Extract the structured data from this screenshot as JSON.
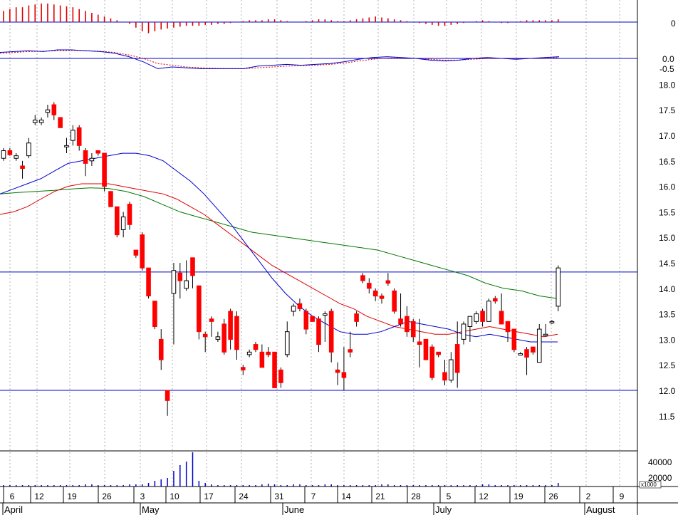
{
  "chart_data": {
    "type": "candlestick",
    "colors": {
      "up": "#ffffff",
      "down": "#ff0000",
      "outline": "#000000",
      "ma_short": "#0000cc",
      "ma_mid": "#dd0000",
      "ma_long": "#007700",
      "hline": "#0000cc",
      "volume": "#0000cc",
      "osc_pos": "#dd0000",
      "macd": "#0000cc",
      "signal": "#dd0000",
      "grid": "#b0b0b0"
    },
    "price_axis": {
      "ylim": [
        11.1,
        18.4
      ],
      "ticks": [
        "18.0",
        "17.5",
        "17.0",
        "16.5",
        "16.0",
        "15.5",
        "15.0",
        "14.5",
        "14.0",
        "13.5",
        "13.0",
        "12.5",
        "12.0",
        "11.5"
      ]
    },
    "osc_axis": {
      "tick": "0"
    },
    "macd_axis": {
      "ticks": [
        "0.0",
        "-0.5"
      ]
    },
    "volume_axis": {
      "ticks": [
        "40000",
        "20000"
      ],
      "unit": "x1000"
    },
    "x_axis": {
      "day_labels": [
        "6",
        "12",
        "19",
        "26",
        "3",
        "10",
        "17",
        "24",
        "31",
        "7",
        "14",
        "21",
        "28",
        "5",
        "12",
        "19",
        "26",
        "2",
        "9"
      ],
      "months": [
        "April",
        "May",
        "June",
        "July",
        "August"
      ]
    },
    "horizontal_lines": [
      14.32,
      12.0
    ],
    "candles": [
      [
        16.55,
        16.75,
        16.5,
        16.7
      ],
      [
        16.7,
        16.75,
        16.6,
        16.62
      ],
      [
        16.55,
        16.65,
        16.5,
        16.6
      ],
      [
        16.4,
        16.5,
        16.15,
        16.35
      ],
      [
        16.6,
        16.95,
        16.55,
        16.85
      ],
      [
        17.25,
        17.4,
        17.2,
        17.3
      ],
      [
        17.25,
        17.35,
        17.2,
        17.3
      ],
      [
        17.45,
        17.6,
        17.35,
        17.5
      ],
      [
        17.6,
        17.65,
        17.3,
        17.4
      ],
      [
        17.35,
        17.35,
        17.15,
        17.15
      ],
      [
        16.8,
        16.95,
        16.65,
        16.8
      ],
      [
        16.9,
        17.2,
        16.8,
        17.1
      ],
      [
        17.15,
        17.2,
        16.7,
        16.8
      ],
      [
        16.7,
        16.75,
        16.2,
        16.45
      ],
      [
        16.5,
        16.65,
        16.4,
        16.55
      ],
      [
        16.7,
        16.7,
        16.6,
        16.65
      ],
      [
        16.65,
        16.65,
        15.9,
        16.0
      ],
      [
        15.9,
        15.9,
        15.6,
        15.6
      ],
      [
        15.6,
        15.6,
        15.0,
        15.05
      ],
      [
        15.15,
        15.5,
        15.0,
        15.4
      ],
      [
        15.65,
        15.7,
        15.15,
        15.25
      ],
      [
        14.75,
        14.75,
        14.6,
        14.65
      ],
      [
        15.05,
        15.1,
        14.35,
        14.4
      ],
      [
        14.4,
        14.4,
        13.8,
        13.85
      ],
      [
        13.75,
        13.75,
        13.2,
        13.25
      ],
      [
        13.0,
        13.2,
        12.4,
        12.6
      ],
      [
        12.0,
        12.0,
        11.5,
        11.8
      ],
      [
        13.9,
        14.5,
        12.9,
        14.35
      ],
      [
        14.3,
        14.5,
        13.8,
        14.15
      ],
      [
        14.0,
        14.55,
        13.95,
        14.15
      ],
      [
        14.6,
        14.6,
        14.0,
        14.25
      ],
      [
        14.05,
        14.05,
        13.0,
        13.15
      ],
      [
        13.1,
        13.15,
        12.75,
        13.05
      ],
      [
        13.4,
        13.45,
        13.05,
        13.35
      ],
      [
        13.0,
        13.15,
        12.95,
        13.05
      ],
      [
        13.3,
        13.4,
        12.7,
        12.75
      ],
      [
        13.55,
        13.6,
        12.8,
        13.0
      ],
      [
        13.45,
        13.55,
        12.6,
        12.8
      ],
      [
        12.45,
        12.5,
        12.3,
        12.4
      ],
      [
        12.7,
        12.8,
        12.65,
        12.75
      ],
      [
        12.9,
        12.95,
        12.75,
        12.8
      ],
      [
        12.75,
        12.9,
        12.45,
        12.45
      ],
      [
        12.75,
        12.85,
        12.65,
        12.7
      ],
      [
        12.75,
        12.75,
        12.05,
        12.05
      ],
      [
        12.4,
        12.45,
        12.05,
        12.15
      ],
      [
        12.7,
        13.35,
        12.65,
        13.15
      ],
      [
        13.55,
        13.7,
        13.45,
        13.65
      ],
      [
        13.7,
        13.8,
        13.55,
        13.6
      ],
      [
        13.55,
        13.6,
        13.1,
        13.2
      ],
      [
        13.45,
        13.45,
        13.35,
        13.35
      ],
      [
        13.4,
        13.45,
        12.75,
        12.9
      ],
      [
        13.5,
        13.55,
        12.95,
        13.5
      ],
      [
        13.55,
        13.6,
        12.55,
        12.75
      ],
      [
        12.4,
        12.55,
        12.1,
        12.35
      ],
      [
        12.35,
        12.85,
        12.0,
        12.25
      ],
      [
        12.8,
        13.15,
        12.65,
        12.75
      ],
      [
        13.5,
        13.55,
        13.25,
        13.35
      ],
      [
        14.25,
        14.3,
        14.1,
        14.15
      ],
      [
        14.1,
        14.2,
        13.9,
        14.0
      ],
      [
        13.95,
        14.0,
        13.75,
        13.85
      ],
      [
        13.85,
        13.9,
        13.7,
        13.8
      ],
      [
        14.15,
        14.3,
        14.05,
        14.1
      ],
      [
        13.95,
        14.0,
        13.5,
        13.55
      ],
      [
        13.4,
        13.9,
        13.25,
        13.3
      ],
      [
        13.45,
        13.65,
        13.05,
        13.15
      ],
      [
        13.35,
        13.4,
        12.95,
        13.05
      ],
      [
        12.95,
        13.4,
        12.45,
        12.9
      ],
      [
        13.0,
        13.0,
        12.6,
        12.6
      ],
      [
        12.85,
        12.9,
        12.2,
        12.25
      ],
      [
        12.75,
        12.75,
        12.65,
        12.7
      ],
      [
        12.35,
        12.6,
        12.1,
        12.2
      ],
      [
        12.2,
        12.75,
        12.15,
        12.6
      ],
      [
        12.9,
        13.35,
        12.05,
        12.35
      ],
      [
        13.0,
        13.35,
        12.9,
        13.3
      ],
      [
        13.25,
        13.35,
        12.95,
        13.45
      ],
      [
        13.35,
        13.55,
        13.3,
        13.5
      ],
      [
        13.55,
        13.6,
        13.25,
        13.35
      ],
      [
        13.35,
        13.8,
        13.35,
        13.75
      ],
      [
        13.8,
        13.85,
        13.7,
        13.75
      ],
      [
        13.55,
        13.9,
        13.3,
        13.3
      ],
      [
        13.35,
        13.35,
        12.95,
        13.15
      ],
      [
        13.2,
        13.2,
        12.75,
        12.8
      ],
      [
        12.7,
        12.75,
        12.7,
        12.72
      ],
      [
        12.8,
        12.85,
        12.3,
        12.65
      ],
      [
        12.85,
        12.85,
        12.7,
        12.75
      ],
      [
        12.55,
        13.3,
        12.55,
        13.2
      ],
      [
        13.1,
        13.3,
        13.05,
        13.1
      ],
      [
        13.35,
        13.38,
        13.3,
        13.35
      ],
      [
        13.65,
        14.45,
        13.55,
        14.4
      ]
    ],
    "ma_short": [
      15.85,
      15.95,
      16.05,
      16.15,
      16.3,
      16.45,
      16.5,
      16.55,
      16.6,
      16.65,
      16.65,
      16.6,
      16.5,
      16.3,
      16.1,
      15.85,
      15.55,
      15.25,
      14.9,
      14.55,
      14.2,
      13.9,
      13.65,
      13.45,
      13.3,
      13.15,
      13.1,
      13.1,
      13.15,
      13.25,
      13.35,
      13.3,
      13.25,
      13.2,
      13.1,
      13.05,
      13.1,
      13.05,
      13.0,
      12.95,
      12.95,
      12.95
    ],
    "ma_mid": [
      15.45,
      15.5,
      15.6,
      15.75,
      15.9,
      16.0,
      16.05,
      16.05,
      16.05,
      16.0,
      15.95,
      15.9,
      15.85,
      15.75,
      15.6,
      15.45,
      15.25,
      15.05,
      14.85,
      14.65,
      14.45,
      14.3,
      14.15,
      14.0,
      13.85,
      13.7,
      13.6,
      13.45,
      13.35,
      13.25,
      13.2,
      13.15,
      13.1,
      13.1,
      13.15,
      13.2,
      13.25,
      13.2,
      13.15,
      13.1,
      13.05,
      13.1
    ],
    "ma_long": [
      15.85,
      15.88,
      15.9,
      15.92,
      15.95,
      15.97,
      15.96,
      15.9,
      15.8,
      15.65,
      15.5,
      15.4,
      15.3,
      15.2,
      15.1,
      15.05,
      15.0,
      14.95,
      14.9,
      14.85,
      14.8,
      14.75,
      14.65,
      14.55,
      14.45,
      14.35,
      14.25,
      14.1,
      14.0,
      13.95,
      13.85,
      13.8
    ],
    "volume": [
      2,
      2,
      2,
      2,
      2,
      2,
      2,
      2,
      2,
      2,
      2,
      2,
      2,
      3,
      3,
      2,
      2,
      2,
      2,
      2,
      3,
      3,
      3,
      5,
      8,
      10,
      12,
      22,
      30,
      35,
      48,
      8,
      5,
      3,
      2,
      2,
      2,
      2,
      2,
      2,
      2,
      3,
      4,
      3,
      2,
      2,
      3,
      3,
      2,
      2,
      2,
      3,
      3,
      2,
      2,
      2,
      2,
      2,
      2,
      2,
      3,
      3,
      2,
      2,
      2,
      2,
      2,
      2,
      2,
      2,
      2,
      2,
      2,
      2,
      2,
      2,
      3,
      3,
      2,
      2,
      2,
      2,
      2,
      2,
      2,
      2,
      2,
      2,
      5
    ],
    "oscillator": [
      0.6,
      0.7,
      0.8,
      0.8,
      0.9,
      0.95,
      1.0,
      1.0,
      0.95,
      0.9,
      0.85,
      0.8,
      0.7,
      0.6,
      0.5,
      0.4,
      0.3,
      0.2,
      0.1,
      0.0,
      -0.1,
      -0.3,
      -0.5,
      -0.6,
      -0.5,
      -0.4,
      -0.35,
      -0.3,
      -0.25,
      -0.2,
      -0.2,
      -0.2,
      -0.15,
      -0.15,
      -0.1,
      -0.1,
      -0.05,
      0.0,
      0.05,
      0.1,
      0.1,
      0.1,
      0.15,
      0.15,
      0.1,
      0.05,
      0.0,
      0.0,
      0.05,
      0.1,
      0.15,
      0.15,
      0.1,
      0.05,
      0.05,
      0.1,
      0.15,
      0.2,
      0.25,
      0.3,
      0.25,
      0.2,
      0.15,
      0.1,
      0.05,
      0.0,
      -0.05,
      -0.1,
      -0.15,
      -0.2,
      -0.2,
      -0.15,
      -0.1,
      -0.05,
      0.0,
      0.05,
      0.1,
      0.05,
      0.0,
      -0.05,
      -0.05,
      0.0,
      0.05,
      0.1,
      0.1,
      0.1,
      0.1,
      0.1,
      0.15
    ],
    "macd_line": [
      0.35,
      0.4,
      0.45,
      0.4,
      0.5,
      0.5,
      0.45,
      0.4,
      0.3,
      0.1,
      -0.2,
      -0.6,
      -0.5,
      -0.55,
      -0.6,
      -0.6,
      -0.6,
      -0.6,
      -0.45,
      -0.4,
      -0.35,
      -0.4,
      -0.35,
      -0.3,
      -0.2,
      -0.05,
      0.05,
      0.1,
      0.05,
      0.0,
      -0.1,
      -0.15,
      -0.1,
      0.0,
      0.05,
      0.0,
      -0.05,
      0.0,
      0.05,
      0.1
    ],
    "signal_line": [
      0.3,
      0.35,
      0.4,
      0.42,
      0.45,
      0.47,
      0.45,
      0.42,
      0.35,
      0.2,
      0.0,
      -0.3,
      -0.4,
      -0.5,
      -0.55,
      -0.58,
      -0.6,
      -0.6,
      -0.55,
      -0.5,
      -0.45,
      -0.42,
      -0.4,
      -0.35,
      -0.28,
      -0.15,
      -0.05,
      0.02,
      0.03,
      0.0,
      -0.05,
      -0.1,
      -0.1,
      -0.05,
      0.0,
      0.0,
      -0.02,
      0.0,
      0.02,
      0.05
    ]
  }
}
